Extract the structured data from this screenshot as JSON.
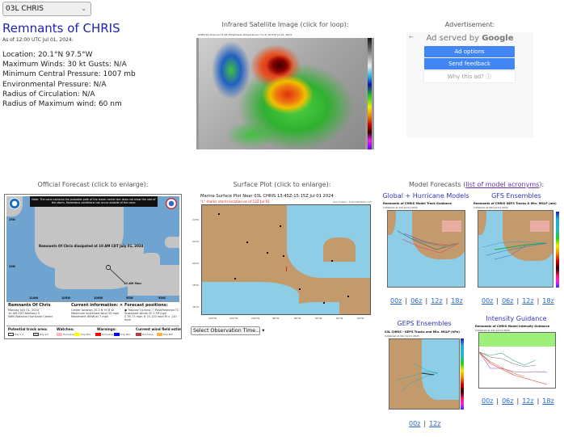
{
  "storm_selector": {
    "value": "03L CHRIS"
  },
  "storm": {
    "title": "Remnants of CHRIS",
    "as_of": "As of 12:00 UTC Jul 01, 2024:",
    "info": [
      "Location: 20.1°N 97.5°W",
      "Maximum Winds: 30 kt  Gusts: N/A",
      "Minimum Central Pressure: 1007 mb",
      "Environmental Pressure: N/A",
      "Radius of Circulation: N/A",
      "Radius of Maximum wind: 60 nm"
    ]
  },
  "satellite": {
    "label": "Infrared Satellite Image (click for loop):",
    "header": "GOES-16 Channel 13 (IR) Brightness Temperature (°C) at 15:07Z Jul 01, 2024"
  },
  "advertisement": {
    "label": "Advertisement:",
    "back_icon": "←",
    "served_by_prefix": "Ad served by ",
    "served_by_brand": "Google",
    "ad_options": "Ad options",
    "send_feedback": "Send feedback",
    "why_this_ad": "Why this ad? ⓘ"
  },
  "official_forecast": {
    "label": "Official Forecast (click to enlarge):",
    "note": "Note: The cone contains the probable path of the storm center but does not show the size of the storm. Hazardous conditions can occur outside of the cone.",
    "dissipated_text": "Remnants Of Chris dissipated at 10 AM CDT July 01, 2024",
    "track_label": "10 AM Mon",
    "lat_labels": [
      "25N",
      "20N"
    ],
    "lon_labels": [
      "110W",
      "105W",
      "100W",
      "95W",
      "90W"
    ],
    "legend": {
      "storm_name": "Remnants Of Chris",
      "storm_lines": [
        "Monday July 01, 2024",
        "10 AM CDT Advisory 4",
        "NWS National Hurricane Center"
      ],
      "current_info_header": "Current information: ×",
      "current_info_lines": [
        "Center location 20.2 N 97.8 W",
        "Maximum sustained wind 35 mph",
        "Movement WNW at 7 mph"
      ],
      "forecast_header": "Forecast positions:",
      "forecast_lines": [
        "● Tropical Cyclone  ○ Post/Potential TC",
        "Sustained winds:       D < 39 mph",
        "S 39-73 mph  H 74-110 mph  M > 110 mph"
      ],
      "track_area_header": "Potential track area:",
      "track_area_items": [
        "Day 1-3",
        "Day 4-5"
      ],
      "watches_header": "Watches:",
      "watches_items": [
        {
          "label": "Hurricane",
          "color": "#ffb6c1"
        },
        {
          "label": "Trop Stm",
          "color": "#ffff00"
        }
      ],
      "warnings_header": "Warnings:",
      "warnings_items": [
        {
          "label": "Hurricane",
          "color": "#ff0000"
        },
        {
          "label": "Trop Stm",
          "color": "#0000ff"
        }
      ],
      "wind_field_header": "Current wind field estimate:",
      "wind_field_items": [
        {
          "label": "Hurricane",
          "color": "#b04040"
        },
        {
          "label": "Trop Stm",
          "color": "#ffb040"
        }
      ]
    }
  },
  "surface_plot": {
    "label": "Surface Plot (click to enlarge):",
    "title": "Marine Surface Plot Near 03L CHRIS 13:45Z-15:15Z Jul 01 2024",
    "subtitle": "\"L\" marks storm location as of 12Z Jul 01",
    "credit": "Levi Cowan - tropicaltidbits.com",
    "lat_labels": [
      "24°N",
      "22°N",
      "20°N",
      "18°N",
      "16°N"
    ],
    "lon_labels": [
      "104°W",
      "102°W",
      "100°W",
      "98°W",
      "96°W",
      "94°W",
      "92°W",
      "90°W"
    ],
    "observation_select": "Select Observation Time... ▾"
  },
  "model_forecasts": {
    "label_prefix": "Model Forecasts (",
    "acronyms_link": "list of model acronyms",
    "label_suffix": "):",
    "panels": [
      {
        "title": "Global + Hurricane Models",
        "image_title": "Remnants of CHRIS Model Track Guidance",
        "image_subtitle": "Initialized at 12z Jul 01 2024",
        "runs": [
          "00z",
          "06z",
          "12z",
          "18z"
        ]
      },
      {
        "title": "GFS Ensembles",
        "image_title": "Remnants of CHRIS GEFS Tracks & Min. MSLP (mb)",
        "image_subtitle": "Initialized at 06z Jul 01 2024",
        "runs": [
          "00z",
          "06z",
          "12z",
          "18z"
        ]
      },
      {
        "title": "GEPS Ensembles",
        "image_title": "03L CHRIS - GEPS Tracks and Min. MSLP (hPa)",
        "image_subtitle": "Initialized at 00z Jul 01 2024",
        "runs": [
          "00z",
          "12z"
        ]
      },
      {
        "title": "Intensity Guidance",
        "image_title": "Remnants of CHRIS Model Intensity Guidance",
        "image_subtitle": "Initialized at 12z Jul 01 2024",
        "runs": [
          "00z",
          "06z",
          "12z",
          "18z"
        ]
      }
    ]
  }
}
